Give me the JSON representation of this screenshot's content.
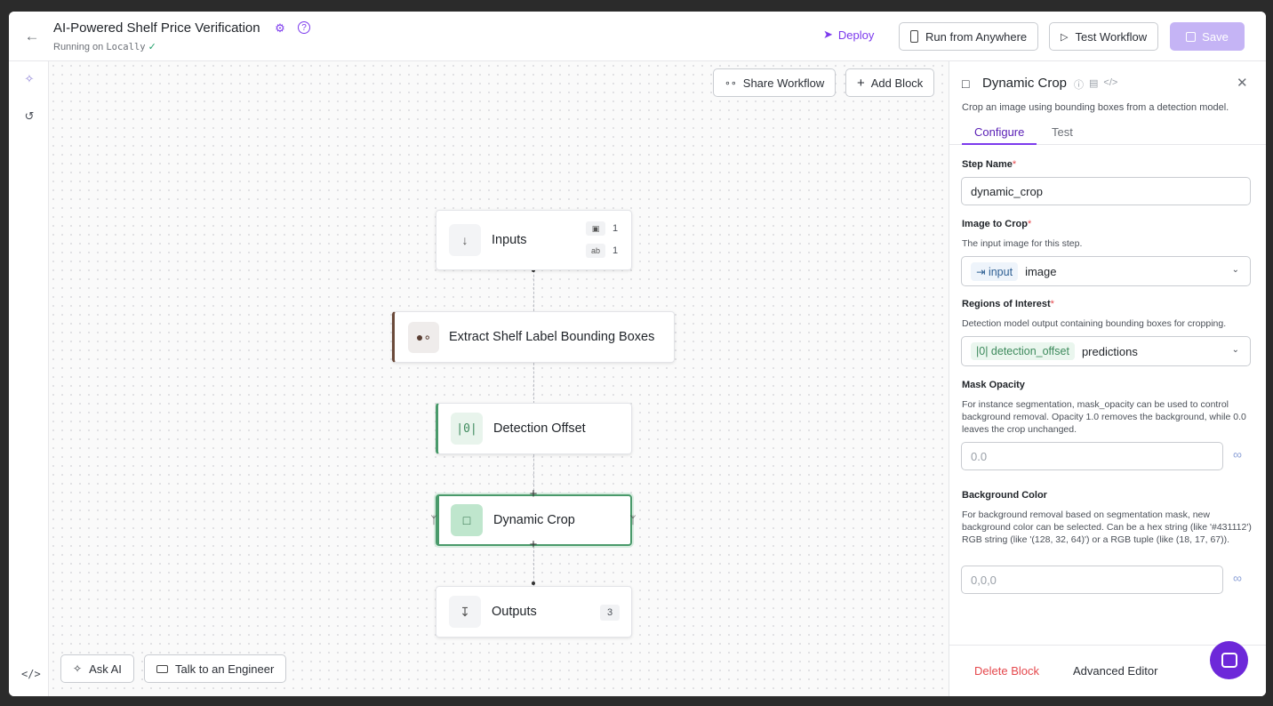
{
  "header": {
    "title": "AI-Powered Shelf Price Verification",
    "running_prefix": "Running on",
    "running_target": "Locally",
    "deploy": "Deploy",
    "run_from_anywhere": "Run from Anywhere",
    "test_workflow": "Test Workflow",
    "save": "Save"
  },
  "canvas": {
    "share_workflow": "Share Workflow",
    "add_block": "Add Block",
    "nodes": {
      "inputs": {
        "label": "Inputs",
        "image_count": "1",
        "param_count": "1"
      },
      "extract": {
        "label": "Extract Shelf Label Bounding Boxes"
      },
      "offset": {
        "label": "Detection Offset"
      },
      "crop": {
        "label": "Dynamic Crop"
      },
      "outputs": {
        "label": "Outputs",
        "count": "3"
      }
    },
    "ask_ai": "Ask AI",
    "talk_engineer": "Talk to an Engineer"
  },
  "panel": {
    "title": "Dynamic Crop",
    "description": "Crop an image using bounding boxes from a detection model.",
    "tabs": [
      "Configure",
      "Test"
    ],
    "step_name": {
      "label": "Step Name",
      "value": "dynamic_crop"
    },
    "image_to_crop": {
      "label": "Image to Crop",
      "help": "The input image for this step.",
      "chip": "input",
      "value": "image"
    },
    "regions": {
      "label": "Regions of Interest",
      "help": "Detection model output containing bounding boxes for cropping.",
      "chip": "detection_offset",
      "value": "predictions"
    },
    "mask_opacity": {
      "label": "Mask Opacity",
      "help": "For instance segmentation, mask_opacity can be used to control background removal. Opacity 1.0 removes the background, while 0.0 leaves the crop unchanged.",
      "placeholder": "0.0"
    },
    "background_color": {
      "label": "Background Color",
      "help": "For background removal based on segmentation mask, new background color can be selected. Can be a hex string (like '#431112') RGB string (like '(128, 32, 64)') or a RGB tuple (like (18, 17, 67)).",
      "placeholder": "0,0,0"
    },
    "delete_block": "Delete Block",
    "advanced_editor": "Advanced Editor"
  },
  "colors": {
    "accent": "#7c3aed",
    "save_disabled": "#c5b4f5",
    "node_green": "#4a9a6b",
    "node_brown": "#6b4a3a",
    "danger": "#e5484d"
  }
}
